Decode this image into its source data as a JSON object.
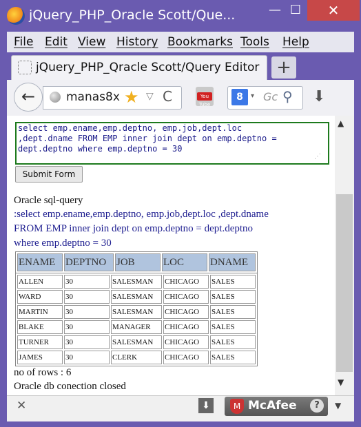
{
  "window": {
    "title": "jQuery_PHP_Oracle Scott/Que...",
    "min_glyph": "—",
    "max_glyph": "☐",
    "close_glyph": "✕"
  },
  "menu": [
    "File",
    "Edit",
    "View",
    "History",
    "Bookmarks",
    "Tools",
    "Help"
  ],
  "tab": {
    "title": "jQuery_PHP_Qracle Scott/Query Editor",
    "new_tab_glyph": "+"
  },
  "toolbar": {
    "back_glyph": "←",
    "url": "manas8x",
    "star_glyph": "★",
    "dropdown_glyph": "▽",
    "reload_glyph": "C",
    "youtube_label": "You Tube",
    "search_engine_glyph": "8",
    "search_dropdown_glyph": "▾",
    "search_placeholder": "Gc",
    "search_glyph": "⚲",
    "download_glyph": "⬇"
  },
  "editor": {
    "query": "select emp.ename,emp.deptno, emp.job,dept.loc\n,dept.dname FROM EMP inner join dept on emp.deptno =\ndept.deptno where emp.deptno = 30",
    "submit_label": "Submit Form"
  },
  "output": {
    "heading": "Oracle sql-query",
    "query_lines": [
      ":select emp.ename,emp.deptno, emp.job,dept.loc ,dept.dname",
      "FROM EMP inner join dept on emp.deptno = dept.deptno",
      "where emp.deptno = 30"
    ],
    "columns": [
      "ENAME",
      "DEPTNO",
      "JOB",
      "LOC",
      "DNAME"
    ],
    "rows": [
      [
        "ALLEN",
        "30",
        "SALESMAN",
        "CHICAGO",
        "SALES"
      ],
      [
        "WARD",
        "30",
        "SALESMAN",
        "CHICAGO",
        "SALES"
      ],
      [
        "MARTIN",
        "30",
        "SALESMAN",
        "CHICAGO",
        "SALES"
      ],
      [
        "BLAKE",
        "30",
        "MANAGER",
        "CHICAGO",
        "SALES"
      ],
      [
        "TURNER",
        "30",
        "SALESMAN",
        "CHICAGO",
        "SALES"
      ],
      [
        "JAMES",
        "30",
        "CLERK",
        "CHICAGO",
        "SALES"
      ]
    ],
    "row_count_text": "no of rows : 6",
    "closed_text": "Oracle db conection closed"
  },
  "bottom": {
    "close_glyph": "✕",
    "download_glyph": "⬇",
    "mcafee_label": "McAfee",
    "help_glyph": "?",
    "menu_glyph": "▼"
  },
  "colors": {
    "title_bar": "#6a5bb0",
    "header_cell": "#b0c4de",
    "query_text": "#1e1e90",
    "textarea_border": "#1d7a1d"
  }
}
